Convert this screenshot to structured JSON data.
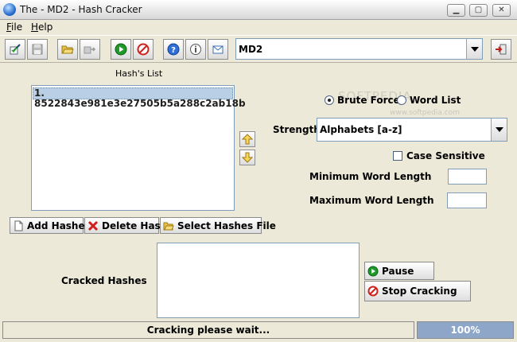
{
  "window": {
    "title": "The - MD2 - Hash Cracker"
  },
  "menu": [
    {
      "first": "F",
      "rest": "ile"
    },
    {
      "first": "H",
      "rest": "elp"
    }
  ],
  "toolbar": {
    "algorithm": "MD2",
    "buttons": [
      "edit-icon",
      "save-icon",
      "open-folder-icon",
      "export-icon",
      "start-icon",
      "stop-icon",
      "help-icon",
      "info-icon",
      "email-icon",
      "exit-icon"
    ]
  },
  "hash_list": {
    "label": "Hash's List",
    "items": [
      "1. 8522843e981e3e27505b5a288c2ab18b"
    ]
  },
  "buttons": {
    "add_hashes": "Add Hashes",
    "delete_hash": "Delete Hash",
    "select_hashes_file": "Select Hashes File",
    "pause": "Pause",
    "stop_cracking": "Stop Cracking"
  },
  "mode": {
    "brute_force": "Brute Force",
    "word_list": "Word List",
    "selected": "brute_force"
  },
  "strength": {
    "label": "Strength",
    "value": "Alphabets [a-z]"
  },
  "case_sensitive": {
    "label": "Case Sensitive",
    "checked": false
  },
  "min_length": {
    "label": "Minimum Word Length",
    "value": ""
  },
  "max_length": {
    "label": "Maximum Word Length",
    "value": ""
  },
  "cracked": {
    "label": "Cracked Hashes",
    "value": ""
  },
  "status": {
    "text": "Cracking please wait...",
    "progress_percent": 100,
    "progress_label": "100%"
  },
  "watermark": {
    "text": "SOFTPEDIA",
    "sub": "www.softpedia.com"
  },
  "colors": {
    "selection": "#b8cfe5",
    "progress": "#8ea7c8",
    "background": "#ece9d8"
  }
}
